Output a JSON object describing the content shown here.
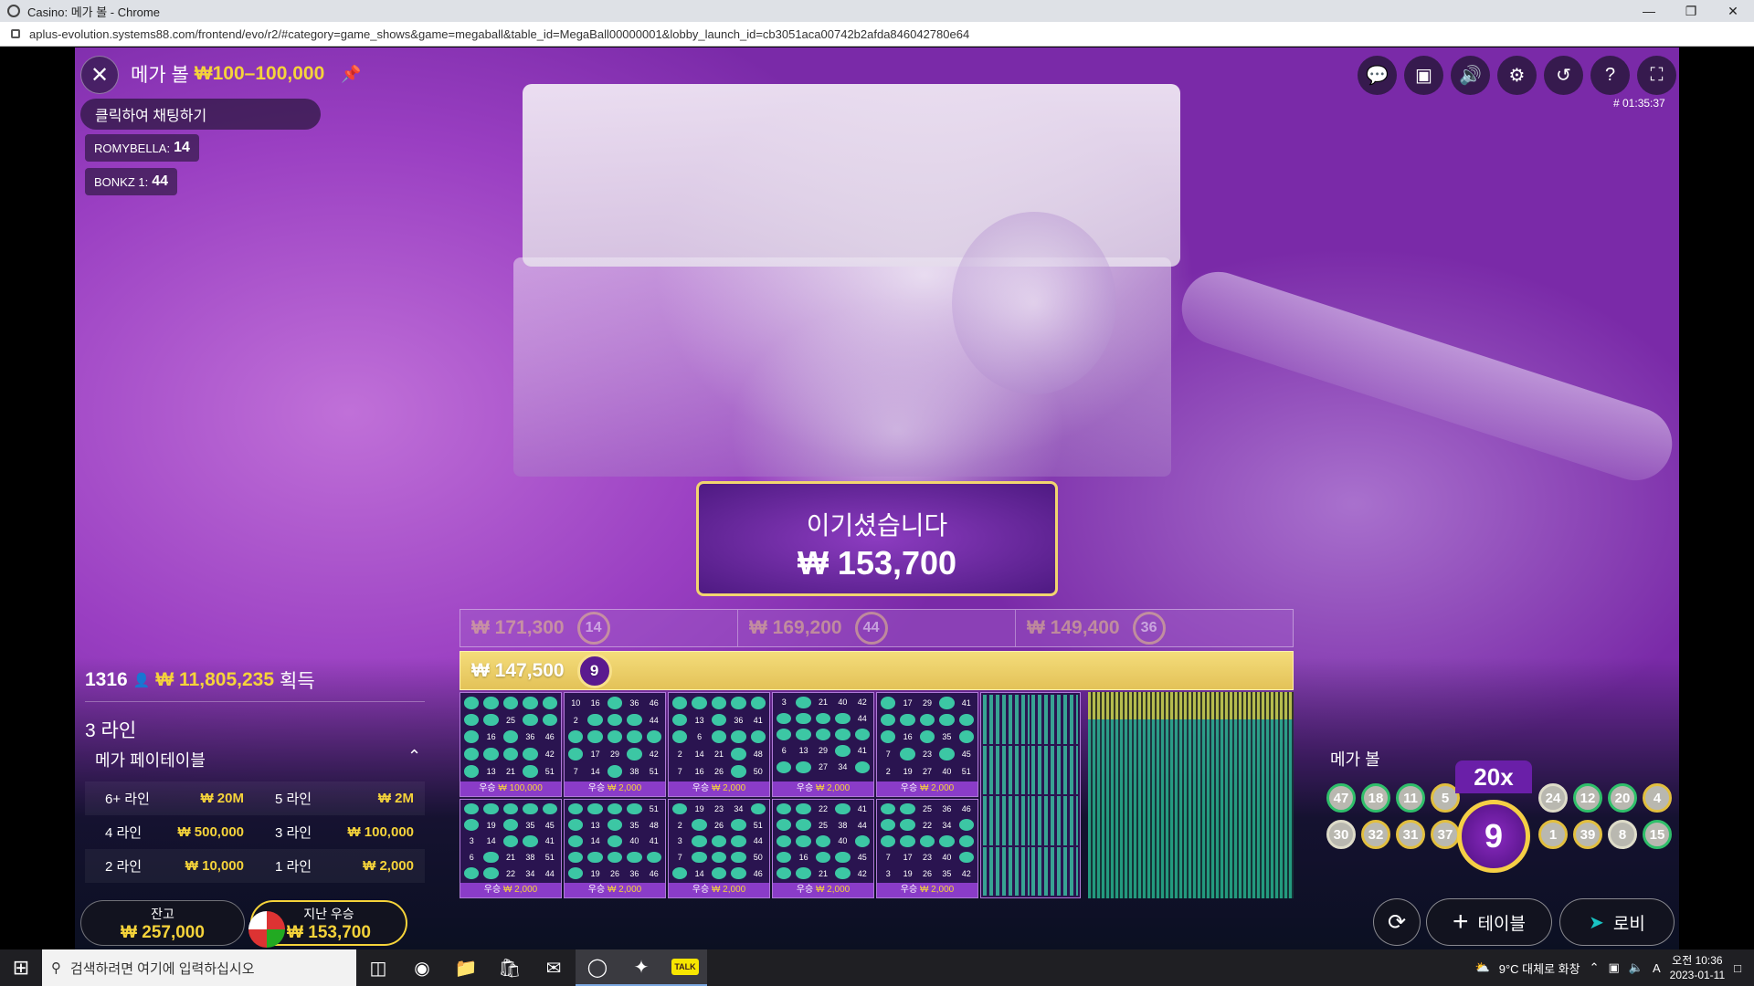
{
  "window": {
    "title": "Casino: 메가 볼 - Chrome"
  },
  "address": {
    "url": "aplus-evolution.systems88.com/frontend/evo/r2/#category=game_shows&game=megaball&table_id=MegaBall00000001&lobby_launch_id=cb3051aca00742b2afda846042780e64"
  },
  "game": {
    "name": "메가 볼",
    "limit": "₩100–100,000",
    "round_id": "# 01:35:37"
  },
  "chat": {
    "placeholder": "클릭하여 채팅하기",
    "messages": [
      {
        "user": "ROMYBELLA:",
        "text": "14"
      },
      {
        "user": "BONKZ 1:",
        "text": "44"
      }
    ]
  },
  "banner": {
    "title": "이기셨습니다",
    "amount": "₩ 153,700"
  },
  "prizes": {
    "row1": [
      {
        "amount": "₩ 171,300",
        "ball": "14"
      },
      {
        "amount": "₩ 169,200",
        "ball": "44"
      },
      {
        "amount": "₩ 149,400",
        "ball": "36"
      }
    ],
    "row2": {
      "amount": "₩ 147,500",
      "ball": "9"
    }
  },
  "cards": [
    {
      "nums": [
        "",
        "",
        "",
        "",
        "",
        "",
        "",
        "25",
        "",
        "",
        "",
        "16",
        "",
        "36",
        "46",
        "",
        "",
        "",
        "",
        "42",
        "",
        "13",
        "21",
        "",
        "51"
      ],
      "win": "₩ 100,000"
    },
    {
      "nums": [
        "10",
        "16",
        "",
        "36",
        "46",
        "2",
        "",
        "",
        "",
        "44",
        "",
        "",
        "",
        "",
        "",
        "",
        "17",
        "29",
        "",
        "42",
        "7",
        "14",
        "",
        "38",
        "51"
      ],
      "win": "₩ 2,000"
    },
    {
      "nums": [
        "",
        "",
        "",
        "",
        "",
        "",
        "13",
        "",
        "36",
        "41",
        "",
        "6",
        "",
        "",
        "",
        "2",
        "14",
        "21",
        "",
        "48",
        "7",
        "16",
        "26",
        "",
        "50"
      ],
      "win": "₩ 2,000"
    },
    {
      "nums": [
        "3",
        "",
        "21",
        "40",
        "42",
        "",
        "",
        "",
        "",
        "44",
        "",
        "",
        "",
        "",
        "",
        "6",
        "13",
        "29",
        "",
        "41",
        "",
        "",
        "27",
        "34",
        "",
        ""
      ],
      "win": "₩ 2,000"
    },
    {
      "nums": [
        "",
        "17",
        "29",
        "",
        "41",
        "",
        "",
        "",
        "",
        "",
        "",
        "16",
        "",
        "35",
        "",
        "7",
        "",
        "23",
        "",
        "45",
        "2",
        "19",
        "27",
        "40",
        "51"
      ],
      "win": "₩ 2,000"
    },
    {
      "nums": [
        "",
        "",
        "",
        "",
        "",
        "",
        "19",
        "",
        "35",
        "45",
        "3",
        "14",
        "",
        "",
        "41",
        "6",
        "",
        "21",
        "38",
        "51",
        "",
        "",
        "22",
        "34",
        "44"
      ],
      "win": "₩ 2,000"
    },
    {
      "nums": [
        "",
        "",
        "",
        "",
        "51",
        "",
        "13",
        "",
        "35",
        "48",
        "",
        "14",
        "",
        "40",
        "41",
        "",
        "",
        "",
        "",
        "",
        "",
        "19",
        "26",
        "36",
        "46"
      ],
      "win": "₩ 2,000"
    },
    {
      "nums": [
        "",
        "19",
        "23",
        "34",
        "",
        "2",
        "",
        "26",
        "",
        "51",
        "3",
        "",
        "",
        "",
        "44",
        "7",
        "",
        "",
        "",
        "50",
        "",
        "14",
        "",
        "",
        "46"
      ],
      "win": "₩ 2,000"
    },
    {
      "nums": [
        "",
        "",
        "22",
        "",
        "41",
        "",
        "",
        "25",
        "38",
        "44",
        "",
        "",
        "",
        "40",
        "",
        "",
        "16",
        "",
        "",
        "45",
        "",
        "",
        "21",
        "",
        "42"
      ],
      "win": "₩ 2,000"
    },
    {
      "nums": [
        "",
        "",
        "25",
        "36",
        "46",
        "",
        "",
        "22",
        "34",
        "",
        "",
        "",
        "",
        "",
        "",
        "7",
        "17",
        "23",
        "40",
        "",
        "3",
        "19",
        "26",
        "35",
        "42"
      ],
      "win": "₩ 2,000"
    }
  ],
  "card_win_prefix": "우승",
  "players": {
    "count": "1316",
    "amount": "₩ 11,805,235",
    "label": "획득"
  },
  "lines_title": "3 라인",
  "paytable": {
    "title": "메가 페이테이블",
    "rows": [
      {
        "label": "6+ 라인",
        "value": "₩ 20M"
      },
      {
        "label": "5 라인",
        "value": "₩ 2M"
      },
      {
        "label": "4 라인",
        "value": "₩ 500,000"
      },
      {
        "label": "3 라인",
        "value": "₩ 100,000"
      },
      {
        "label": "2 라인",
        "value": "₩ 10,000"
      },
      {
        "label": "1 라인",
        "value": "₩ 2,000"
      }
    ]
  },
  "balance": {
    "label": "잔고",
    "value": "₩ 257,000"
  },
  "last_win": {
    "label": "지난 우승",
    "value": "₩ 153,700"
  },
  "drawn": {
    "label": "메가 볼",
    "row1": [
      "47",
      "18",
      "11",
      "5",
      "24",
      "12",
      "20",
      "4"
    ],
    "row2": [
      "30",
      "32",
      "31",
      "37",
      "1",
      "39",
      "8",
      "15"
    ],
    "mega_ball": "9",
    "multiplier": "20x"
  },
  "buttons": {
    "table": "테이블",
    "lobby": "로비"
  },
  "taskbar": {
    "search_placeholder": "검색하려면 여기에 입력하십시오",
    "weather": "9°C  대체로 화창",
    "time": "오전 10:36",
    "date": "2023-01-11",
    "lang": "A",
    "chat_app": "TALK"
  },
  "colors": {
    "accent_gold": "#f5d33a",
    "purple": "#5a1a8f",
    "green_cell": "#3cc7a4"
  }
}
